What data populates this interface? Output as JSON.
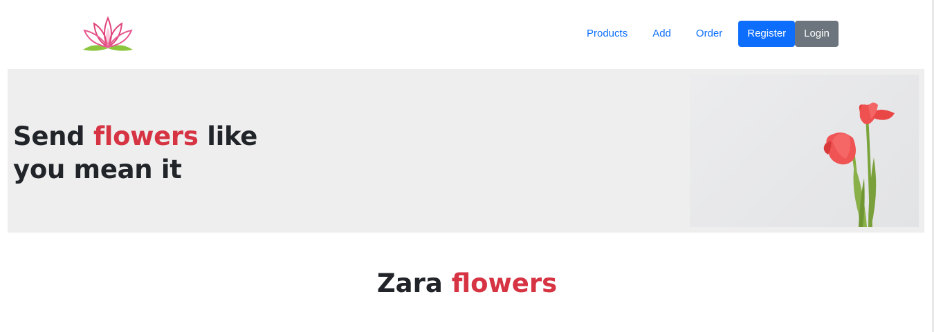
{
  "nav": {
    "logo_icon": "lotus-logo-icon",
    "links": [
      {
        "label": "Products"
      },
      {
        "label": "Add"
      },
      {
        "label": "Order"
      }
    ],
    "register_label": "Register",
    "login_label": "Login"
  },
  "hero": {
    "title_part1": "Send ",
    "title_accent": "flowers",
    "title_part2": " like you mean it",
    "image_icon": "tulips-image"
  },
  "section": {
    "title_part1": "Zara ",
    "title_accent": "flowers"
  },
  "colors": {
    "accent": "#d63343",
    "primary": "#0d6efd",
    "secondary": "#6c757d",
    "hero_bg": "#eeeeee",
    "text": "#212529"
  }
}
